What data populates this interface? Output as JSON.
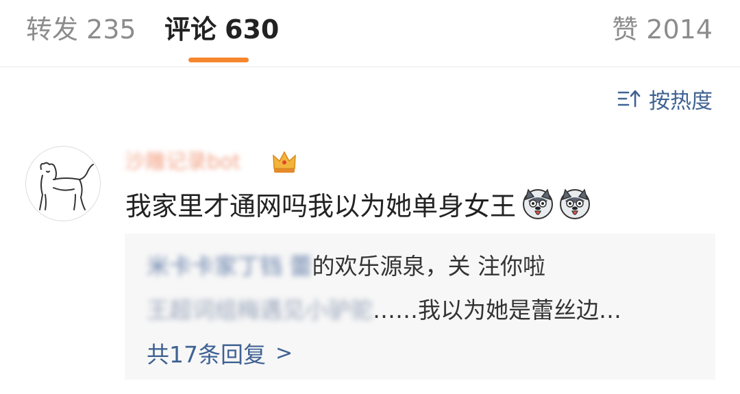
{
  "tabs": {
    "repost": {
      "label": "转发",
      "count": "235"
    },
    "comments": {
      "label": "评论",
      "count": "630"
    },
    "likes": {
      "label": "赞",
      "count": "2014"
    }
  },
  "accent_color": "#f6862e",
  "link_color": "#3f6293",
  "sort": {
    "label": "按热度",
    "icon": "sort-icon"
  },
  "comment": {
    "username": "沙雕记录bot",
    "badge_icon": "crown-icon",
    "avatar": "cat-drawing-avatar",
    "text": "我家里才通网吗我以为她单身女王",
    "emojis": [
      "husky-emoji",
      "husky-emoji"
    ]
  },
  "replies": {
    "items": [
      {
        "name": "米卡卡家丁铛 蕾",
        "text": "的欢乐源泉，关 注你啦"
      },
      {
        "name": "王超词组梅遇见小驴驼",
        "text": "……我以为她是蕾丝边…"
      }
    ],
    "more_label": "共17条回复",
    "more_chevron": ">"
  }
}
